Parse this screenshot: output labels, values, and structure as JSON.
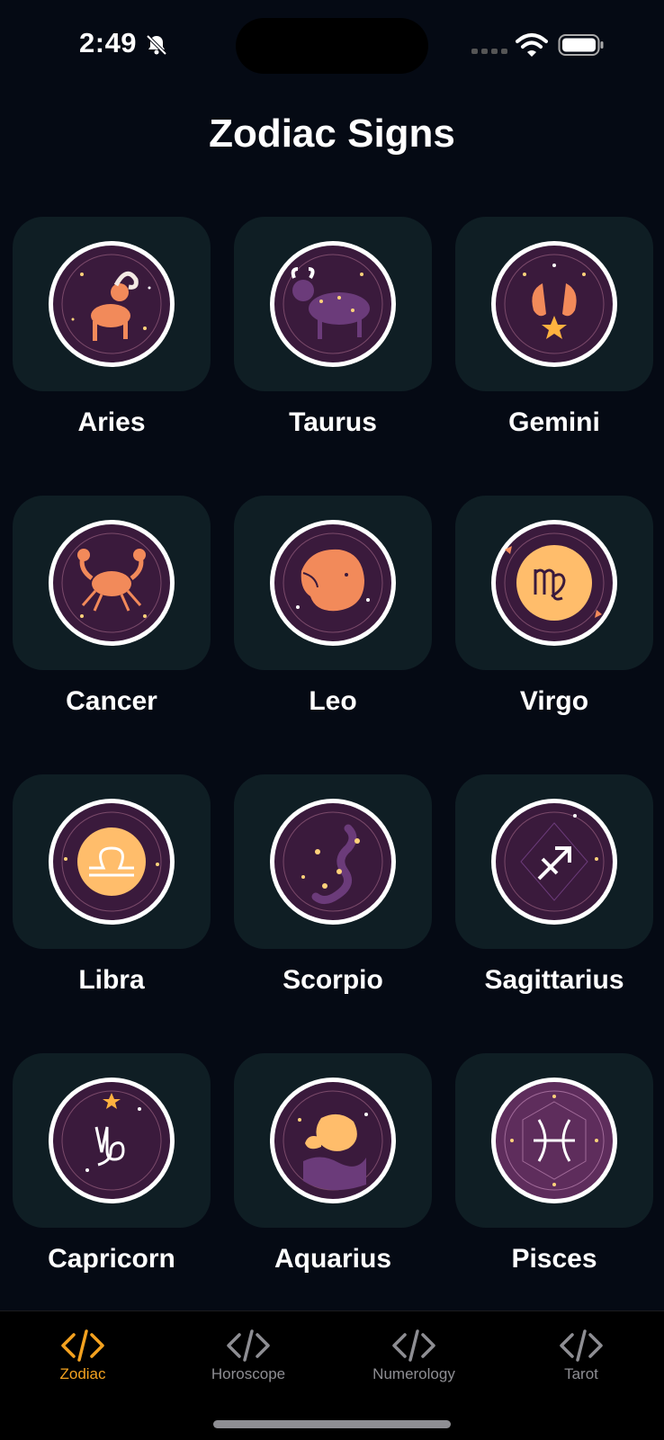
{
  "status_bar": {
    "time": "2:49"
  },
  "page": {
    "title": "Zodiac Signs"
  },
  "colors": {
    "accent": "#f4a21f",
    "tab_inactive": "#8e8e93",
    "card": "#0f1e24",
    "emblem_purple": "#3a1a3c",
    "emblem_orange": "#f28a5a"
  },
  "signs": [
    {
      "name": "Aries",
      "icon": "aries-ram-icon"
    },
    {
      "name": "Taurus",
      "icon": "taurus-bull-icon"
    },
    {
      "name": "Gemini",
      "icon": "gemini-twins-icon"
    },
    {
      "name": "Cancer",
      "icon": "cancer-crab-icon"
    },
    {
      "name": "Leo",
      "icon": "leo-lion-icon"
    },
    {
      "name": "Virgo",
      "icon": "virgo-glyph-icon"
    },
    {
      "name": "Libra",
      "icon": "libra-glyph-icon"
    },
    {
      "name": "Scorpio",
      "icon": "scorpio-constellation-icon"
    },
    {
      "name": "Sagittarius",
      "icon": "sagittarius-glyph-icon"
    },
    {
      "name": "Capricorn",
      "icon": "capricorn-glyph-icon"
    },
    {
      "name": "Aquarius",
      "icon": "aquarius-fish-icon"
    },
    {
      "name": "Pisces",
      "icon": "pisces-glyph-icon"
    }
  ],
  "tabs": [
    {
      "label": "Zodiac",
      "active": true
    },
    {
      "label": "Horoscope",
      "active": false
    },
    {
      "label": "Numerology",
      "active": false
    },
    {
      "label": "Tarot",
      "active": false
    }
  ]
}
